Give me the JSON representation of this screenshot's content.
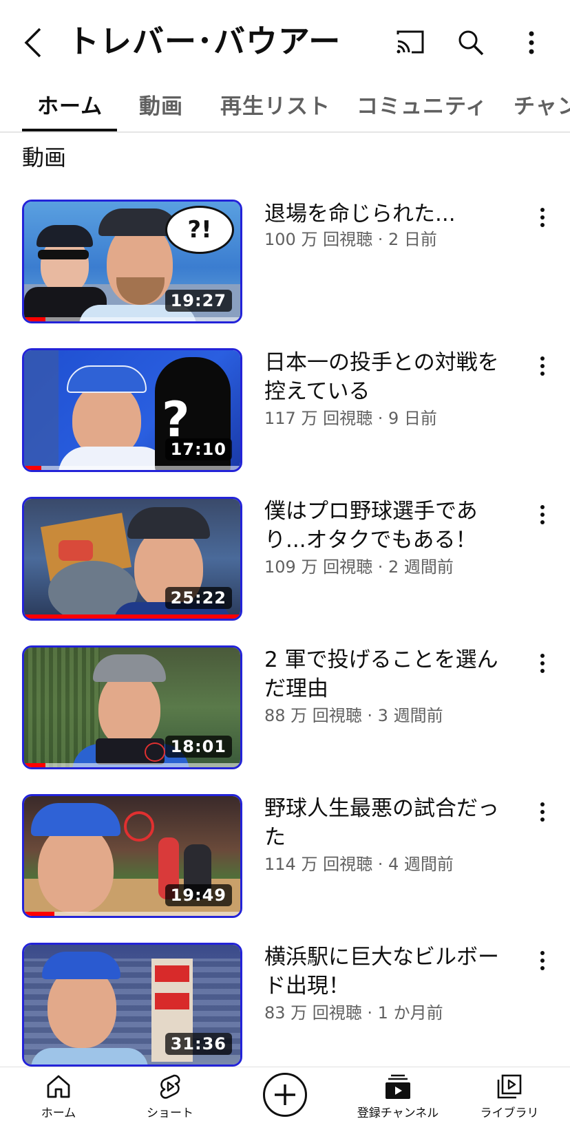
{
  "header": {
    "channel_title": "トレバー･バウアー",
    "back_icon": "chevron-left-icon",
    "cast_icon": "cast-icon",
    "search_icon": "search-icon",
    "more_icon": "more-vertical-icon"
  },
  "tabs": [
    {
      "label": "ホーム",
      "active": true
    },
    {
      "label": "動画",
      "active": false
    },
    {
      "label": "再生リスト",
      "active": false
    },
    {
      "label": "コミュニティ",
      "active": false
    },
    {
      "label": "チャン",
      "active": false
    }
  ],
  "section": {
    "title": "動画"
  },
  "videos": [
    {
      "title": "退場を命じられた...",
      "meta": "100 万 回視聴 · 2 日前",
      "duration": "19:27",
      "watched_fraction": 0.1
    },
    {
      "title": "日本一の投手との対戦を控えている",
      "meta": "117 万 回視聴 · 9 日前",
      "duration": "17:10",
      "watched_fraction": 0.08
    },
    {
      "title": "僕はプロ野球選手であり...オタクでもある！",
      "meta": "109 万 回視聴 · 2 週間前",
      "duration": "25:22",
      "watched_fraction": 1.0
    },
    {
      "title": "2 軍で投げることを選んだ理由",
      "meta": "88 万 回視聴 · 3 週間前",
      "duration": "18:01",
      "watched_fraction": 0.1
    },
    {
      "title": "野球人生最悪の試合だった",
      "meta": "114 万 回視聴 · 4 週間前",
      "duration": "19:49",
      "watched_fraction": 0.14
    },
    {
      "title": "横浜駅に巨大なビルボード出現！",
      "meta": "83 万 回視聴 · 1 か月前",
      "duration": "31:36",
      "watched_fraction": 0.0
    }
  ],
  "bottom_nav": [
    {
      "label": "ホーム",
      "icon": "home-icon"
    },
    {
      "label": "ショート",
      "icon": "shorts-icon"
    },
    {
      "label": "",
      "icon": "create-plus-icon"
    },
    {
      "label": "登録チャンネル",
      "icon": "subscriptions-icon"
    },
    {
      "label": "ライブラリ",
      "icon": "library-icon"
    }
  ],
  "colors": {
    "accent_red": "#ff0000",
    "thumb_border": "#2323d8",
    "text_primary": "#0f0f0f",
    "text_secondary": "#606060"
  }
}
